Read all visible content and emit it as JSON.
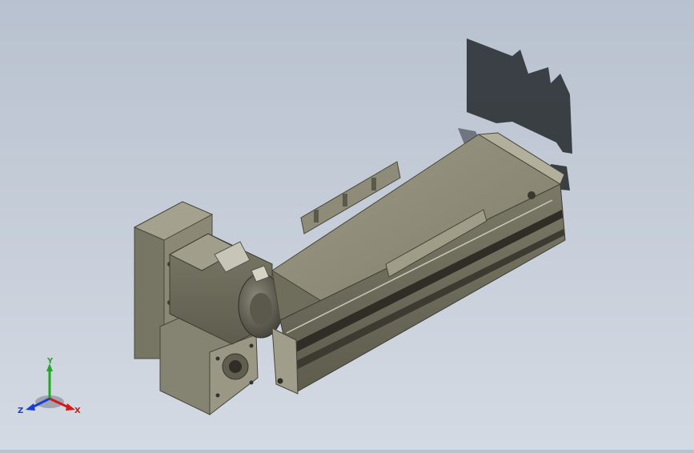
{
  "viewport": {
    "background_top": "#b8c1cf",
    "background_bottom": "#d4dae3",
    "model_color": "#8f8d78",
    "model_dark": "#5b5a4b",
    "shadow_color": "#2f3438"
  },
  "triad": {
    "x_label": "X",
    "y_label": "Y",
    "z_label": "Z",
    "x_color": "#d21a1a",
    "y_color": "#1faa1f",
    "z_color": "#1a3fd2"
  }
}
